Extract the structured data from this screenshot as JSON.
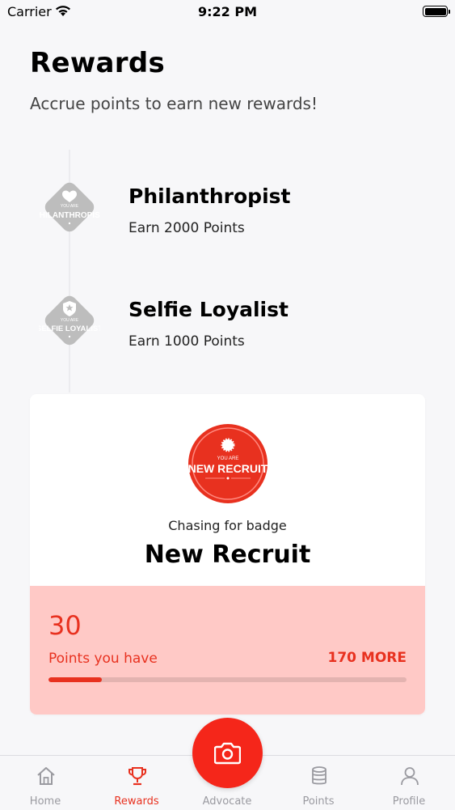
{
  "status_bar": {
    "carrier": "Carrier",
    "time": "9:22 PM"
  },
  "header": {
    "title": "Rewards",
    "subtitle": "Accrue points to earn new rewards!"
  },
  "rewards": [
    {
      "name": "Philanthropist",
      "requirement": "Earn 2000 Points",
      "badge_you_are": "YOU ARE",
      "badge_text": "PHILANTHROPIST",
      "badge_icon": "heart-icon"
    },
    {
      "name": "Selfie Loyalist",
      "requirement": "Earn 1000 Points",
      "badge_you_are": "YOU ARE",
      "badge_text": "SELFIE LOYALIST",
      "badge_icon": "star-shield-icon"
    }
  ],
  "current": {
    "badge_you_are": "YOU ARE",
    "badge_text": "NEW RECRUIT",
    "chasing_label": "Chasing for badge",
    "badge_name": "New Recruit",
    "points": "30",
    "points_label": "Points you have",
    "more_label": "170 MORE",
    "progress": 0.15
  },
  "tabs": [
    {
      "label": "Home",
      "icon": "home-icon",
      "active": false
    },
    {
      "label": "Rewards",
      "icon": "trophy-icon",
      "active": true
    },
    {
      "label": "Advocate",
      "icon": "camera-icon",
      "active": false
    },
    {
      "label": "Points",
      "icon": "coins-icon",
      "active": false
    },
    {
      "label": "Profile",
      "icon": "person-icon",
      "active": false
    }
  ],
  "colors": {
    "accent": "#e8311f",
    "fab": "#f5261a",
    "points_panel": "#ffc9c6",
    "inactive_tab": "#9a9aa0",
    "badge_grey": "#bdbdbd"
  }
}
